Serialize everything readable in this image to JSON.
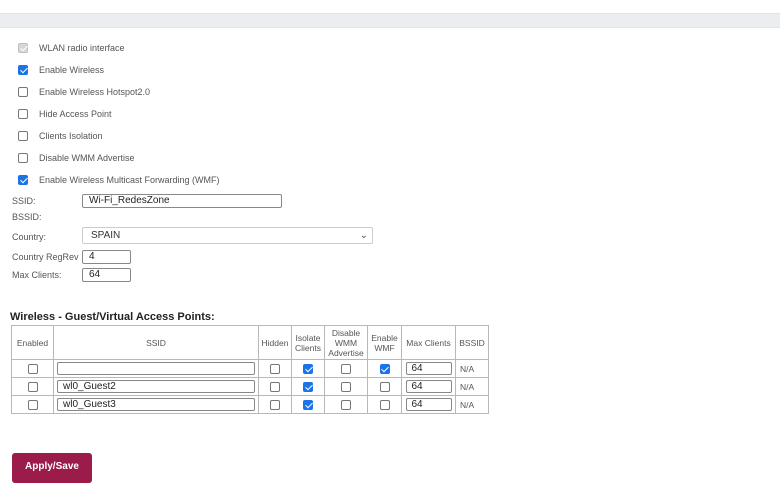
{
  "checkboxes": [
    {
      "label": "WLAN radio interface",
      "checked": true,
      "disabled": true
    },
    {
      "label": "Enable Wireless",
      "checked": true,
      "disabled": false
    },
    {
      "label": "Enable Wireless Hotspot2.0",
      "checked": false,
      "disabled": false
    },
    {
      "label": "Hide Access Point",
      "checked": false,
      "disabled": false
    },
    {
      "label": "Clients Isolation",
      "checked": false,
      "disabled": false
    },
    {
      "label": "Disable WMM Advertise",
      "checked": false,
      "disabled": false
    },
    {
      "label": "Enable Wireless Multicast Forwarding (WMF)",
      "checked": true,
      "disabled": false
    }
  ],
  "fields": {
    "ssid_label": "SSID:",
    "ssid_value": "Wi-Fi_RedesZone",
    "bssid_label": "BSSID:",
    "country_label": "Country:",
    "country_value": "SPAIN",
    "regrev_label": "Country RegRev",
    "regrev_value": "4",
    "maxclients_label": "Max Clients:",
    "maxclients_value": "64"
  },
  "guest": {
    "title": "Wireless - Guest/Virtual Access Points:",
    "headers": {
      "enabled": "Enabled",
      "ssid": "SSID",
      "hidden": "Hidden",
      "isolate": "Isolate Clients",
      "wmm": "Disable WMM Advertise",
      "wmf": "Enable WMF",
      "max": "Max Clients",
      "bssid": "BSSID"
    },
    "rows": [
      {
        "enabled": false,
        "ssid": "",
        "hidden": false,
        "isolate": true,
        "wmm": false,
        "wmf": true,
        "max": "64",
        "bssid": "N/A"
      },
      {
        "enabled": false,
        "ssid": "wl0_Guest2",
        "hidden": false,
        "isolate": true,
        "wmm": false,
        "wmf": false,
        "max": "64",
        "bssid": "N/A"
      },
      {
        "enabled": false,
        "ssid": "wl0_Guest3",
        "hidden": false,
        "isolate": true,
        "wmm": false,
        "wmf": false,
        "max": "64",
        "bssid": "N/A"
      }
    ]
  },
  "apply_label": "Apply/Save",
  "colors": {
    "checkbox_checked": "#1a73e8",
    "apply_button": "#9b1c4a"
  }
}
